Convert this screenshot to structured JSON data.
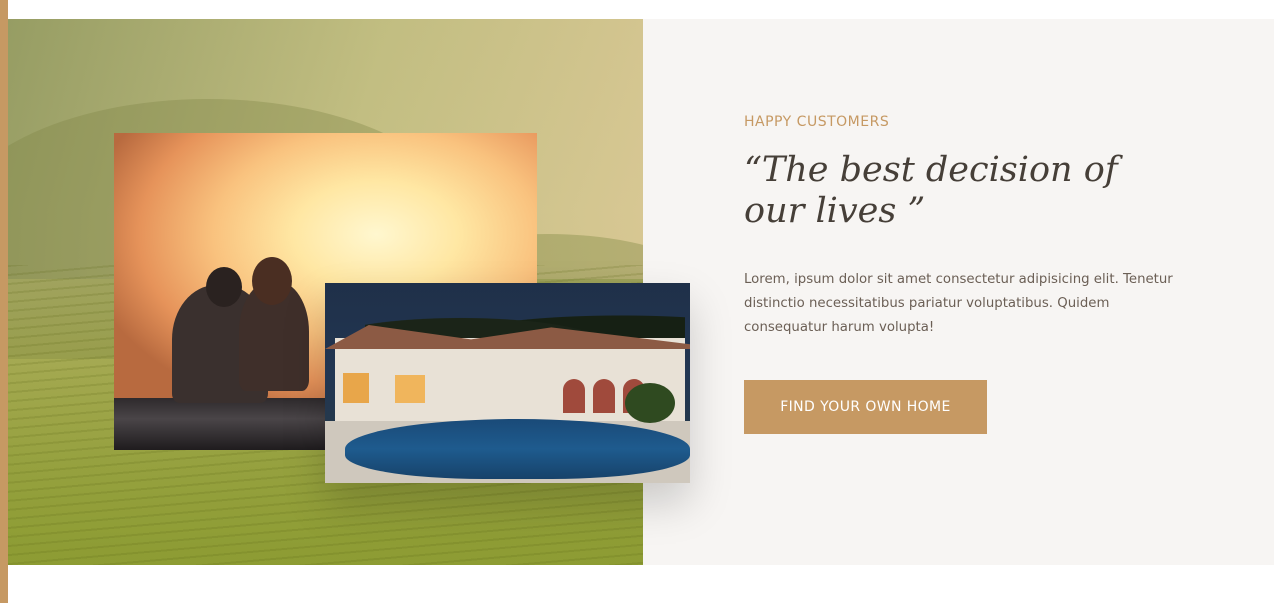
{
  "testimonial": {
    "eyebrow": "HAPPY CUSTOMERS",
    "heading": "“The best decision of our lives ”",
    "body": "Lorem, ipsum dolor sit amet consectetur adipisicing elit. Tenetur distinctio necessitatibus pariatur voluptatibus. Quidem consequatur harum volupta!",
    "cta_label": "FIND YOUR OWN HOME"
  },
  "colors": {
    "accent": "#c69963",
    "heading": "#463f38",
    "body": "#6b5f55",
    "panel": "#f7f5f3"
  }
}
